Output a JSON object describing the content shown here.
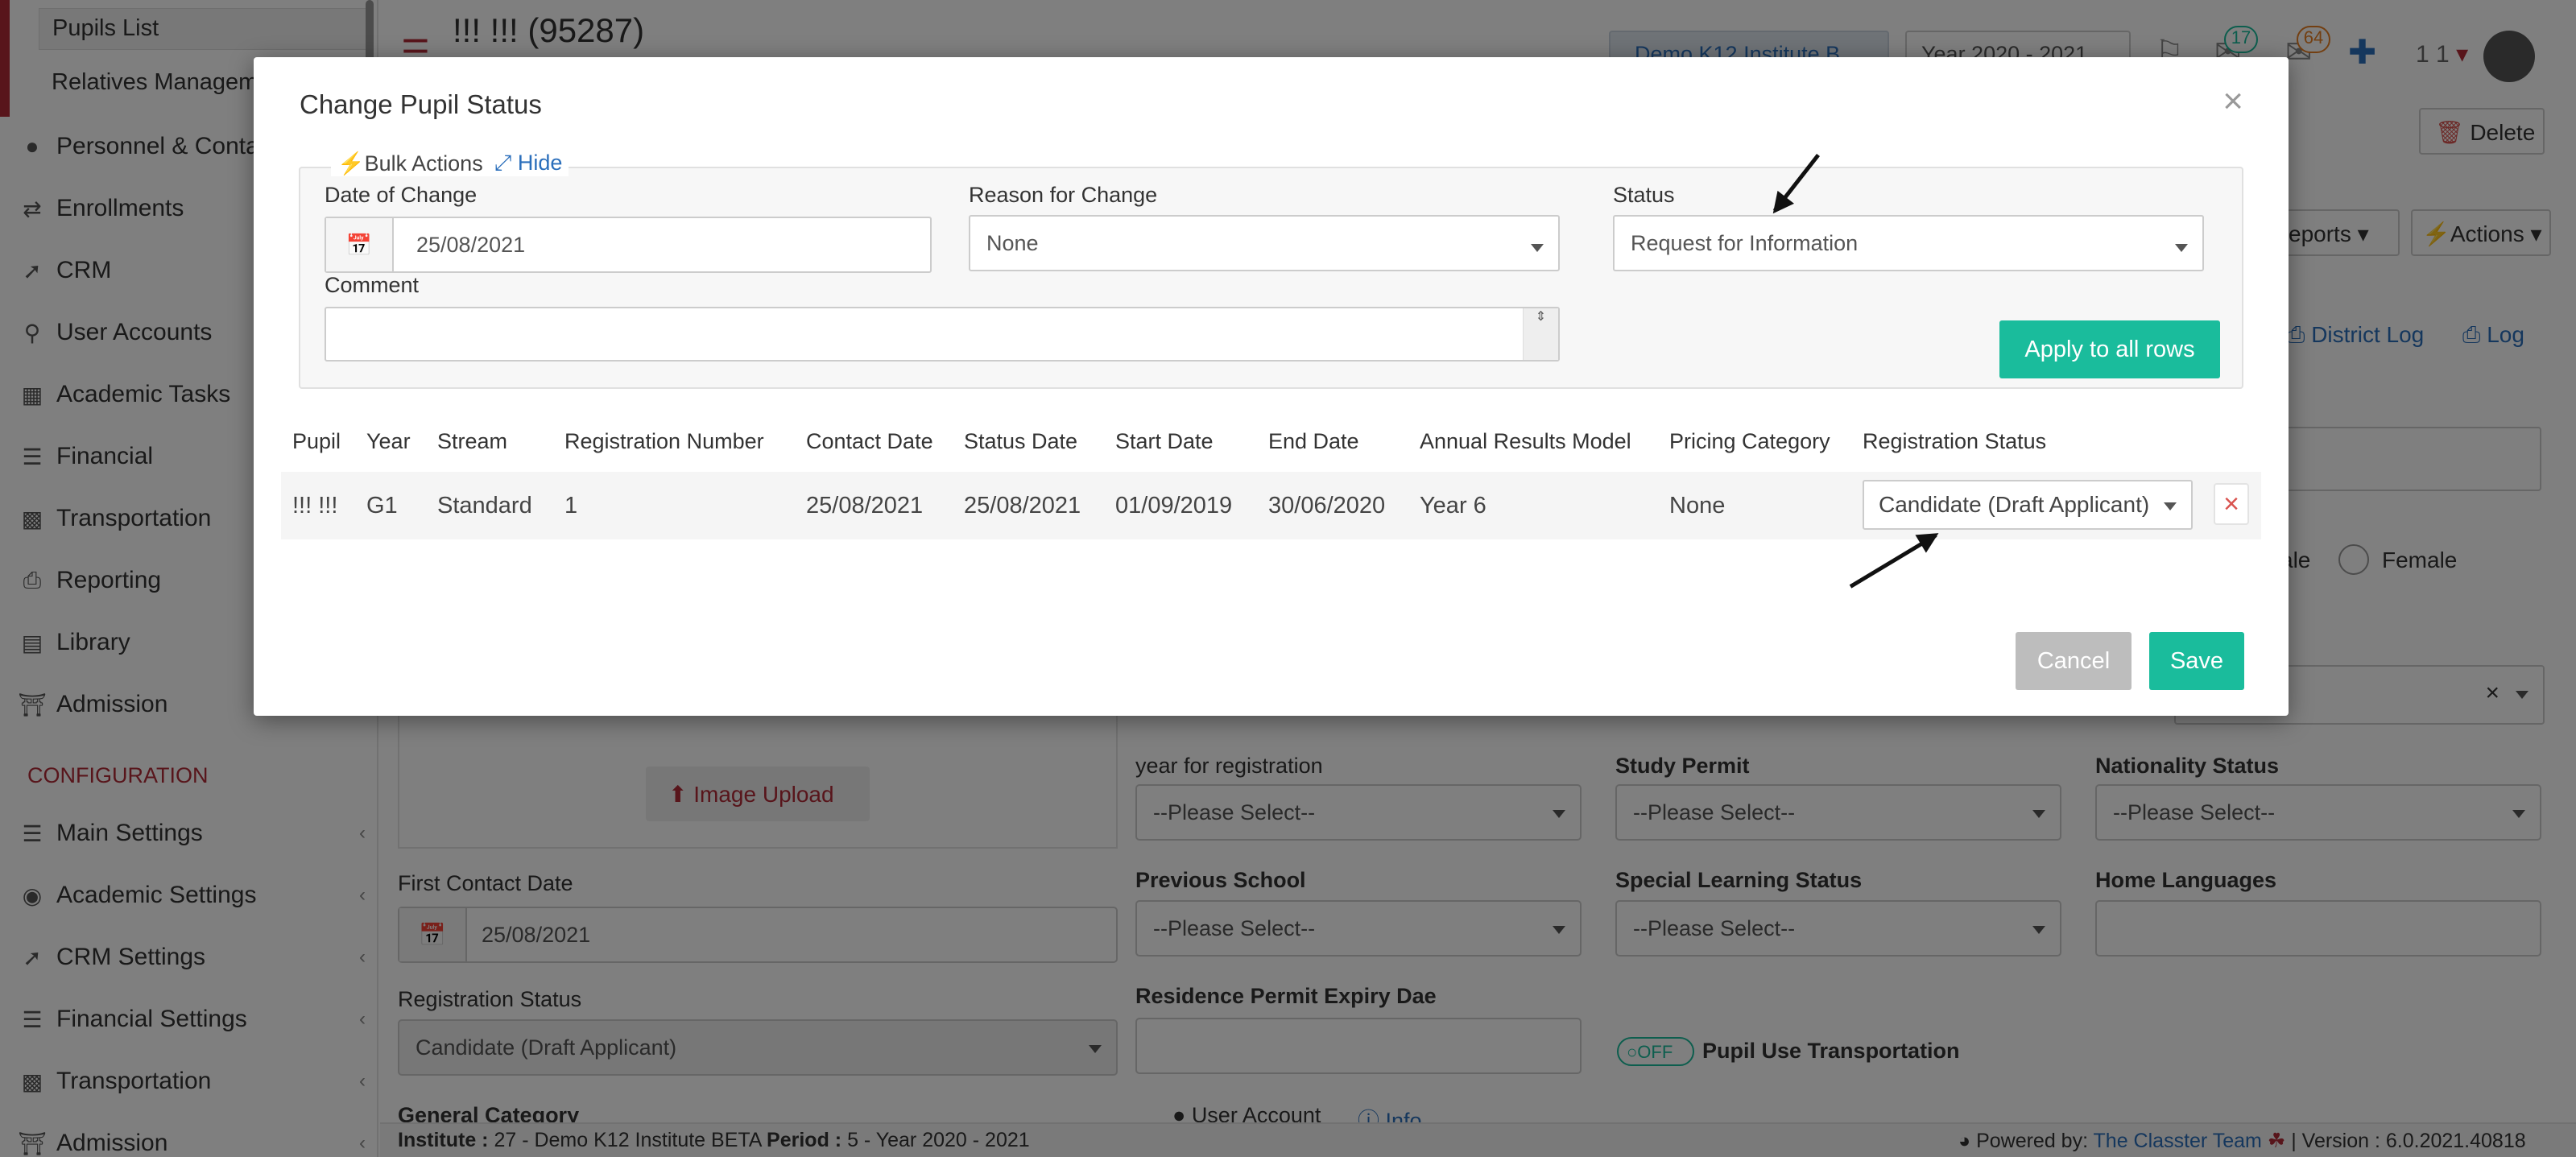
{
  "sidebar": {
    "pupils_list": "Pupils List",
    "relatives": "Relatives Managem",
    "items": [
      {
        "label": "Personnel & Conta",
        "icon": "person-icon"
      },
      {
        "label": "Enrollments",
        "icon": "exchange-icon"
      },
      {
        "label": "CRM",
        "icon": "crm-icon"
      },
      {
        "label": "User Accounts",
        "icon": "key-icon"
      },
      {
        "label": "Academic Tasks",
        "icon": "grid-icon"
      },
      {
        "label": "Financial",
        "icon": "coins-icon"
      },
      {
        "label": "Transportation",
        "icon": "bus-icon"
      },
      {
        "label": "Reporting",
        "icon": "printer-icon"
      },
      {
        "label": "Library",
        "icon": "books-icon"
      },
      {
        "label": "Admission",
        "icon": "bank-icon"
      }
    ],
    "config_heading": "CONFIGURATION",
    "config_items": [
      {
        "label": "Main Settings",
        "icon": "sliders-icon"
      },
      {
        "label": "Academic Settings",
        "icon": "group-icon"
      },
      {
        "label": "CRM Settings",
        "icon": "crm-icon"
      },
      {
        "label": "Financial Settings",
        "icon": "coins-icon"
      },
      {
        "label": "Transportation",
        "icon": "bus-icon"
      },
      {
        "label": "Admission",
        "icon": "bank-icon"
      }
    ]
  },
  "topbar": {
    "page_title": "!!! !!! (95287)",
    "institute": "Demo K12 Institute B",
    "year": "Year 2020 - 2021",
    "badge_messages": "17",
    "badge_notifications": "64",
    "user_short": "1 1"
  },
  "background": {
    "delete": "Delete",
    "reports": "eports",
    "actions": "Actions",
    "district_log": "District Log",
    "log": "Log",
    "gender_male": "ale",
    "gender_female": "Female",
    "image_upload": "Image Upload",
    "year_for_registration_label": "year for registration",
    "year_for_registration_value": "--Please Select--",
    "study_permit_label": "Study Permit",
    "study_permit_value": "--Please Select--",
    "nationality_label": "Nationality Status",
    "nationality_value": "--Please Select--",
    "first_contact_label": "First Contact Date",
    "first_contact_value": "25/08/2021",
    "previous_school_label": "Previous School",
    "previous_school_value": "--Please Select--",
    "special_learning_label": "Special Learning Status",
    "special_learning_value": "--Please Select--",
    "home_languages_label": "Home Languages",
    "registration_status_label": "Registration Status",
    "registration_status_value": "Candidate (Draft Applicant)",
    "residence_permit_label": "Residence Permit Expiry Dae",
    "transport_toggle": "OFF",
    "transport_label": "Pupil Use Transportation",
    "general_category": "General Category",
    "user_account": "User Account",
    "info": "Info"
  },
  "footer": {
    "institute_label": "Institute :",
    "institute_value": "27 - Demo K12 Institute BETA",
    "period_label": "Period :",
    "period_value": "5 - Year 2020 - 2021",
    "powered_by": "Powered by:",
    "team": "The Classter Team",
    "version": "| Version : 6.0.2021.40818"
  },
  "modal": {
    "title": "Change Pupil Status",
    "bulk_actions": "Bulk Actions",
    "hide": "Hide",
    "date_label": "Date of Change",
    "date_value": "25/08/2021",
    "reason_label": "Reason for Change",
    "reason_value": "None",
    "status_label": "Status",
    "status_value": "Request for Information",
    "comment_label": "Comment",
    "apply_button": "Apply to all rows",
    "columns": [
      "Pupil",
      "Year",
      "Stream",
      "Registration Number",
      "Contact Date",
      "Status Date",
      "Start Date",
      "End Date",
      "Annual Results Model",
      "Pricing Category",
      "Registration Status"
    ],
    "row": {
      "pupil": "!!! !!!",
      "year": "G1",
      "stream": "Standard",
      "registration_number": "1",
      "contact_date": "25/08/2021",
      "status_date": "25/08/2021",
      "start_date": "01/09/2019",
      "end_date": "30/06/2020",
      "annual_results_model": "Year 6",
      "pricing_category": "None",
      "registration_status": "Candidate (Draft Applicant)"
    },
    "cancel_button": "Cancel",
    "save_button": "Save"
  },
  "colors": {
    "accent": "#1abc9c",
    "danger": "#d9534f",
    "brand_red": "#b02a37"
  }
}
